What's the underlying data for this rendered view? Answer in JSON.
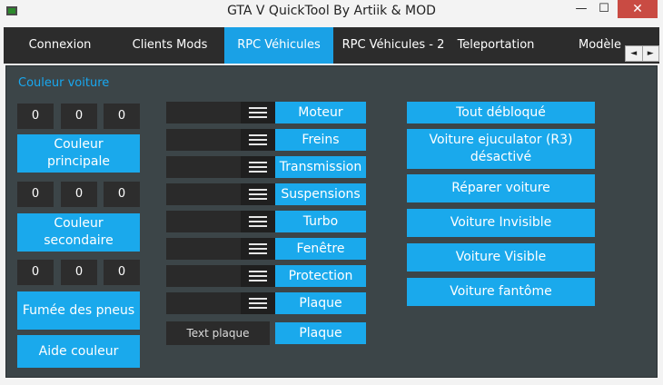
{
  "window": {
    "title": "GTA V QuickTool By Artiik & MOD",
    "min_glyph": "—",
    "max_glyph": "☐",
    "close_glyph": "✕"
  },
  "tabs": [
    {
      "label": "Connexion",
      "active": false
    },
    {
      "label": "Clients Mods",
      "active": false
    },
    {
      "label": "RPC Véhicules",
      "active": true
    },
    {
      "label": "RPC Véhicules - 2",
      "active": false
    },
    {
      "label": "Teleportation",
      "active": false
    },
    {
      "label": "Modèle",
      "active": false
    }
  ],
  "scroll": {
    "left": "◄",
    "right": "►"
  },
  "panel": {
    "group_label": "Couleur voiture",
    "color_rows": [
      {
        "values": [
          "0",
          "0",
          "0"
        ],
        "button": "Couleur\nprincipale"
      },
      {
        "values": [
          "0",
          "0",
          "0"
        ],
        "button": "Couleur\nsecondaire"
      },
      {
        "values": [
          "0",
          "0",
          "0"
        ],
        "button": "Fumée des pneus"
      }
    ],
    "aide_button": "Aide couleur",
    "mods": [
      "Moteur",
      "Freins",
      "Transmission",
      "Suspensions",
      "Turbo",
      "Fenêtre",
      "Protection",
      "Plaque"
    ],
    "plate_input_placeholder": "Text plaque",
    "plate_button": "Plaque",
    "right_buttons": [
      "Tout débloqué",
      "Voiture ejuculator (R3)\ndésactivé",
      "Réparer voiture",
      "Voiture Invisible",
      "Voiture Visible",
      "Voiture fantôme"
    ]
  },
  "colors": {
    "accent": "#1aa9ec",
    "panel_bg": "#3c4548",
    "tab_bar": "#2c2c2c",
    "close_red": "#c94b43"
  }
}
